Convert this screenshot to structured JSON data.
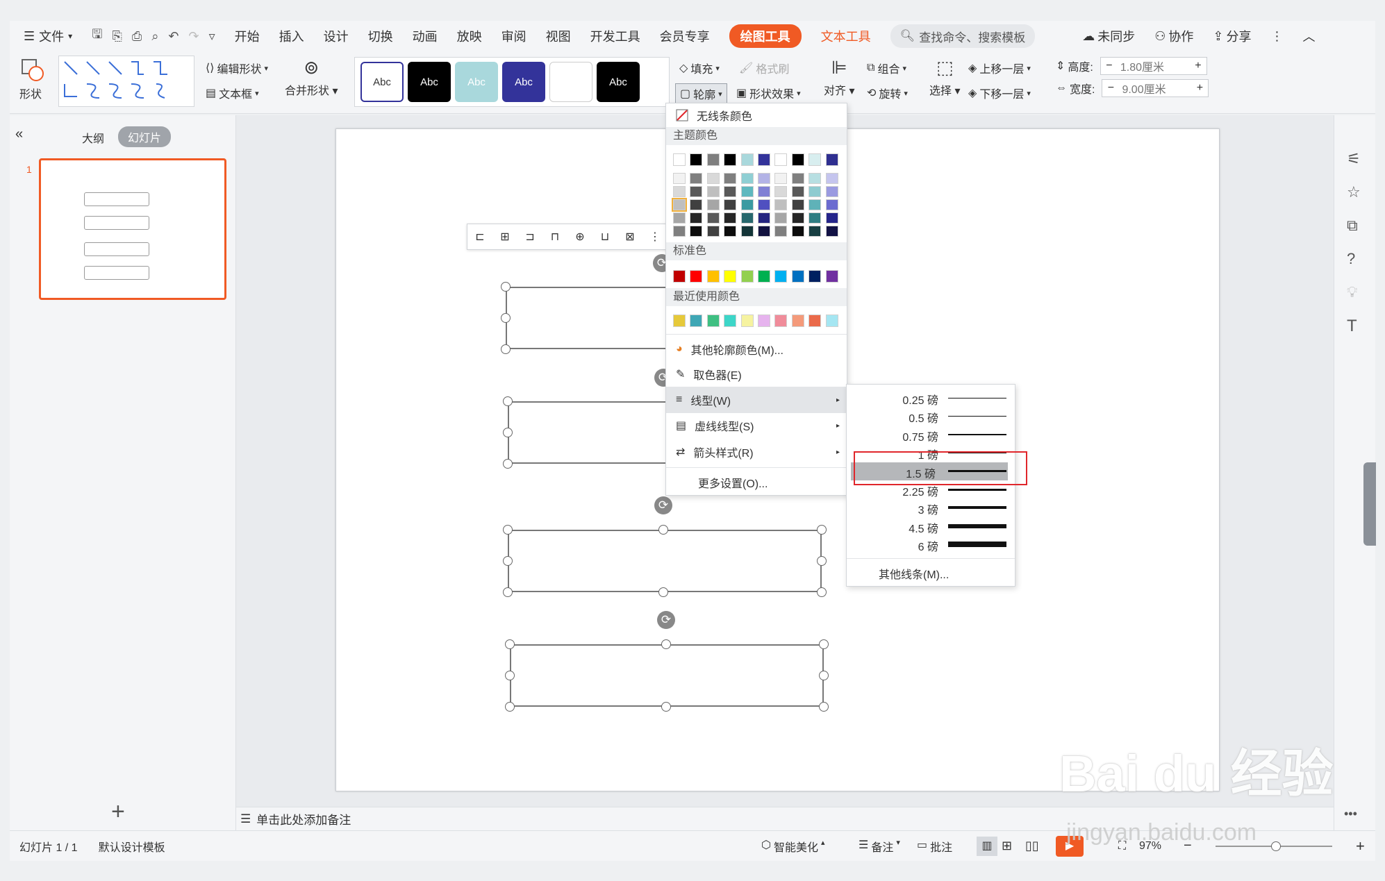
{
  "titlebar": {
    "file": "文件",
    "tabs": [
      "开始",
      "插入",
      "设计",
      "切换",
      "动画",
      "放映",
      "审阅",
      "视图",
      "开发工具",
      "会员专享"
    ],
    "drawing_tools": "绘图工具",
    "text_tools": "文本工具",
    "search": "查找命令、搜索模板",
    "unsync": "未同步",
    "collab": "协作",
    "share": "分享"
  },
  "ribbon": {
    "shape": "形状",
    "edit_shape": "编辑形状",
    "textbox": "文本框",
    "merge_shape": "合并形状",
    "style_samples": [
      "Abc",
      "Abc",
      "Abc",
      "Abc",
      "",
      "Abc"
    ],
    "fill": "填充",
    "format_brush": "格式刷",
    "outline": "轮廓",
    "shape_effect": "形状效果",
    "align": "对齐",
    "group": "组合",
    "rotate": "旋转",
    "select": "选择",
    "bring_forward": "上移一层",
    "send_backward": "下移一层",
    "height_label": "高度:",
    "height_value": "1.80厘米",
    "width_label": "宽度:",
    "width_value": "9.00厘米"
  },
  "panel": {
    "outline_tab": "大纲",
    "slides_tab": "幻灯片",
    "slide_number": "1",
    "add": "+"
  },
  "notes": "单击此处添加备注",
  "menu": {
    "no_line": "无线条颜色",
    "theme_colors": "主题颜色",
    "standard_colors": "标准色",
    "recent_colors": "最近使用颜色",
    "more_colors": "其他轮廓颜色(M)...",
    "eyedropper": "取色器(E)",
    "line_style": "线型(W)",
    "dash_style": "虚线线型(S)",
    "arrow_style": "箭头样式(R)",
    "more_settings": "更多设置(O)..."
  },
  "colors": {
    "theme_top": [
      "#ffffff",
      "#000000",
      "#7f7f7f",
      "#000000",
      "#a9d8dc",
      "#33339a",
      "#ffffff",
      "#000000",
      "#d8eeef",
      "#2f2f90"
    ],
    "theme_cols": [
      [
        "#f2f2f2",
        "#d9d9d9",
        "#bfbfbf",
        "#a6a6a6",
        "#7f7f7f"
      ],
      [
        "#7f7f7f",
        "#595959",
        "#404040",
        "#262626",
        "#0d0d0d"
      ],
      [
        "#d9d9d9",
        "#bfbfbf",
        "#a6a6a6",
        "#595959",
        "#404040"
      ],
      [
        "#7f7f7f",
        "#595959",
        "#404040",
        "#262626",
        "#0d0d0d"
      ],
      [
        "#8fcfd4",
        "#5fb8bf",
        "#3b9aa1",
        "#27686d",
        "#143538"
      ],
      [
        "#b3b3e6",
        "#8080d4",
        "#5050c0",
        "#262680",
        "#131340"
      ],
      [
        "#f2f2f2",
        "#d9d9d9",
        "#bfbfbf",
        "#a6a6a6",
        "#7f7f7f"
      ],
      [
        "#7f7f7f",
        "#595959",
        "#404040",
        "#262626",
        "#0d0d0d"
      ],
      [
        "#b7dfe2",
        "#8ecbd0",
        "#5fb2b8",
        "#2f7e83",
        "#183f42"
      ],
      [
        "#c5c5ee",
        "#9a9ae0",
        "#6b6bd0",
        "#25258a",
        "#121245"
      ]
    ],
    "standard": [
      "#c00000",
      "#ff0000",
      "#ffc000",
      "#ffff00",
      "#92d050",
      "#00b050",
      "#00b0f0",
      "#0070c0",
      "#002060",
      "#7030a0"
    ],
    "recent": [
      "#e6c93a",
      "#3fa7b5",
      "#3fbf82",
      "#3dd6c8",
      "#f6f3a0",
      "#e6b3ee",
      "#f08c9a",
      "#f49a7a",
      "#ea6a4a",
      "#a5e6f2"
    ],
    "accent": "#f05a24",
    "highlight_red": "#e0262b"
  },
  "submenu": {
    "lines": [
      {
        "label": "0.25 磅",
        "w": 1
      },
      {
        "label": "0.5 磅",
        "w": 1
      },
      {
        "label": "0.75 磅",
        "w": 1.5
      },
      {
        "label": "1 磅",
        "w": 2
      },
      {
        "label": "1.5 磅",
        "w": 2.5
      },
      {
        "label": "2.25 磅",
        "w": 3
      },
      {
        "label": "3 磅",
        "w": 4
      },
      {
        "label": "4.5 磅",
        "w": 6
      },
      {
        "label": "6 磅",
        "w": 8
      }
    ],
    "selected_index": 4,
    "more_lines": "其他线条(M)..."
  },
  "status": {
    "slide_info": "幻灯片 1 / 1",
    "template": "默认设计模板",
    "beautify": "智能美化",
    "notes": "备注",
    "comment": "批注",
    "zoom": "97%"
  },
  "watermark": {
    "main": "Bai du 经验",
    "sub": "jingyan.baidu.com"
  }
}
